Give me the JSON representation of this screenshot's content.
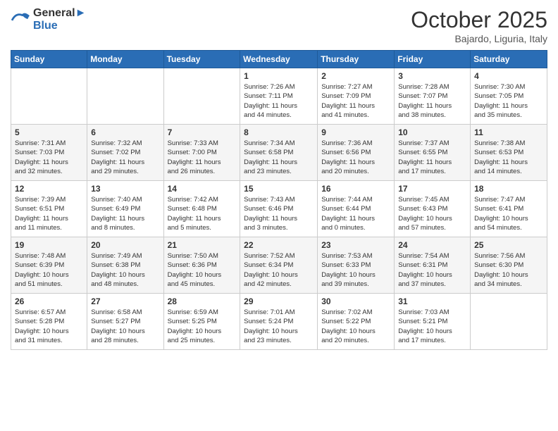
{
  "logo": {
    "line1": "General",
    "line2": "Blue"
  },
  "header": {
    "title": "October 2025",
    "subtitle": "Bajardo, Liguria, Italy"
  },
  "weekdays": [
    "Sunday",
    "Monday",
    "Tuesday",
    "Wednesday",
    "Thursday",
    "Friday",
    "Saturday"
  ],
  "weeks": [
    [
      {
        "day": "",
        "info": ""
      },
      {
        "day": "",
        "info": ""
      },
      {
        "day": "",
        "info": ""
      },
      {
        "day": "1",
        "info": "Sunrise: 7:26 AM\nSunset: 7:11 PM\nDaylight: 11 hours\nand 44 minutes."
      },
      {
        "day": "2",
        "info": "Sunrise: 7:27 AM\nSunset: 7:09 PM\nDaylight: 11 hours\nand 41 minutes."
      },
      {
        "day": "3",
        "info": "Sunrise: 7:28 AM\nSunset: 7:07 PM\nDaylight: 11 hours\nand 38 minutes."
      },
      {
        "day": "4",
        "info": "Sunrise: 7:30 AM\nSunset: 7:05 PM\nDaylight: 11 hours\nand 35 minutes."
      }
    ],
    [
      {
        "day": "5",
        "info": "Sunrise: 7:31 AM\nSunset: 7:03 PM\nDaylight: 11 hours\nand 32 minutes."
      },
      {
        "day": "6",
        "info": "Sunrise: 7:32 AM\nSunset: 7:02 PM\nDaylight: 11 hours\nand 29 minutes."
      },
      {
        "day": "7",
        "info": "Sunrise: 7:33 AM\nSunset: 7:00 PM\nDaylight: 11 hours\nand 26 minutes."
      },
      {
        "day": "8",
        "info": "Sunrise: 7:34 AM\nSunset: 6:58 PM\nDaylight: 11 hours\nand 23 minutes."
      },
      {
        "day": "9",
        "info": "Sunrise: 7:36 AM\nSunset: 6:56 PM\nDaylight: 11 hours\nand 20 minutes."
      },
      {
        "day": "10",
        "info": "Sunrise: 7:37 AM\nSunset: 6:55 PM\nDaylight: 11 hours\nand 17 minutes."
      },
      {
        "day": "11",
        "info": "Sunrise: 7:38 AM\nSunset: 6:53 PM\nDaylight: 11 hours\nand 14 minutes."
      }
    ],
    [
      {
        "day": "12",
        "info": "Sunrise: 7:39 AM\nSunset: 6:51 PM\nDaylight: 11 hours\nand 11 minutes."
      },
      {
        "day": "13",
        "info": "Sunrise: 7:40 AM\nSunset: 6:49 PM\nDaylight: 11 hours\nand 8 minutes."
      },
      {
        "day": "14",
        "info": "Sunrise: 7:42 AM\nSunset: 6:48 PM\nDaylight: 11 hours\nand 5 minutes."
      },
      {
        "day": "15",
        "info": "Sunrise: 7:43 AM\nSunset: 6:46 PM\nDaylight: 11 hours\nand 3 minutes."
      },
      {
        "day": "16",
        "info": "Sunrise: 7:44 AM\nSunset: 6:44 PM\nDaylight: 11 hours\nand 0 minutes."
      },
      {
        "day": "17",
        "info": "Sunrise: 7:45 AM\nSunset: 6:43 PM\nDaylight: 10 hours\nand 57 minutes."
      },
      {
        "day": "18",
        "info": "Sunrise: 7:47 AM\nSunset: 6:41 PM\nDaylight: 10 hours\nand 54 minutes."
      }
    ],
    [
      {
        "day": "19",
        "info": "Sunrise: 7:48 AM\nSunset: 6:39 PM\nDaylight: 10 hours\nand 51 minutes."
      },
      {
        "day": "20",
        "info": "Sunrise: 7:49 AM\nSunset: 6:38 PM\nDaylight: 10 hours\nand 48 minutes."
      },
      {
        "day": "21",
        "info": "Sunrise: 7:50 AM\nSunset: 6:36 PM\nDaylight: 10 hours\nand 45 minutes."
      },
      {
        "day": "22",
        "info": "Sunrise: 7:52 AM\nSunset: 6:34 PM\nDaylight: 10 hours\nand 42 minutes."
      },
      {
        "day": "23",
        "info": "Sunrise: 7:53 AM\nSunset: 6:33 PM\nDaylight: 10 hours\nand 39 minutes."
      },
      {
        "day": "24",
        "info": "Sunrise: 7:54 AM\nSunset: 6:31 PM\nDaylight: 10 hours\nand 37 minutes."
      },
      {
        "day": "25",
        "info": "Sunrise: 7:56 AM\nSunset: 6:30 PM\nDaylight: 10 hours\nand 34 minutes."
      }
    ],
    [
      {
        "day": "26",
        "info": "Sunrise: 6:57 AM\nSunset: 5:28 PM\nDaylight: 10 hours\nand 31 minutes."
      },
      {
        "day": "27",
        "info": "Sunrise: 6:58 AM\nSunset: 5:27 PM\nDaylight: 10 hours\nand 28 minutes."
      },
      {
        "day": "28",
        "info": "Sunrise: 6:59 AM\nSunset: 5:25 PM\nDaylight: 10 hours\nand 25 minutes."
      },
      {
        "day": "29",
        "info": "Sunrise: 7:01 AM\nSunset: 5:24 PM\nDaylight: 10 hours\nand 23 minutes."
      },
      {
        "day": "30",
        "info": "Sunrise: 7:02 AM\nSunset: 5:22 PM\nDaylight: 10 hours\nand 20 minutes."
      },
      {
        "day": "31",
        "info": "Sunrise: 7:03 AM\nSunset: 5:21 PM\nDaylight: 10 hours\nand 17 minutes."
      },
      {
        "day": "",
        "info": ""
      }
    ]
  ]
}
